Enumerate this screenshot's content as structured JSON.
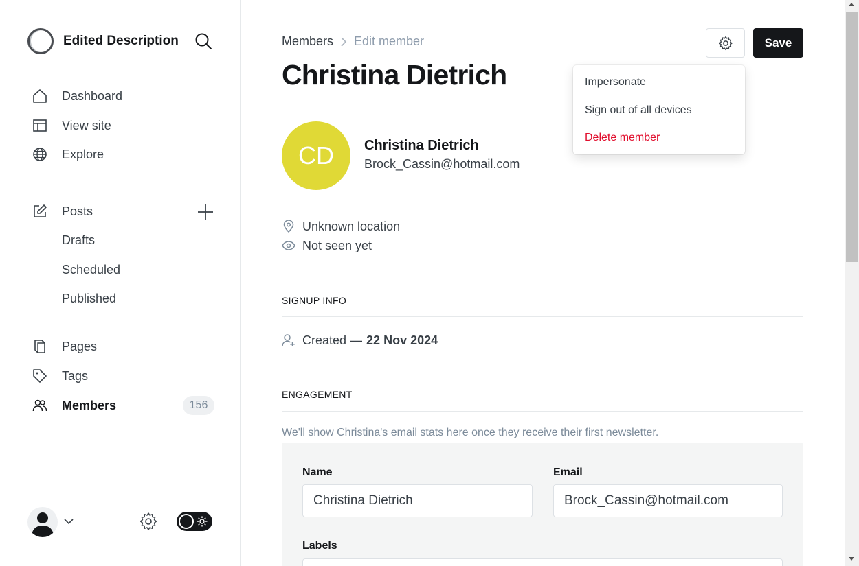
{
  "sidebar": {
    "site_title": "Edited Description",
    "nav": {
      "dashboard": "Dashboard",
      "view_site": "View site",
      "explore": "Explore",
      "posts": "Posts",
      "drafts": "Drafts",
      "scheduled": "Scheduled",
      "published": "Published",
      "pages": "Pages",
      "tags": "Tags",
      "members": "Members",
      "members_count": "156"
    }
  },
  "header": {
    "breadcrumb_parent": "Members",
    "breadcrumb_current": "Edit member",
    "title": "Christina Dietrich",
    "save_label": "Save"
  },
  "actions_menu": {
    "impersonate": "Impersonate",
    "sign_out": "Sign out of all devices",
    "delete": "Delete member"
  },
  "member": {
    "initials": "CD",
    "name": "Christina Dietrich",
    "email": "Brock_Cassin@hotmail.com",
    "location": "Unknown location",
    "last_seen": "Not seen yet",
    "avatar_color": "#e0d936"
  },
  "signup": {
    "heading": "SIGNUP INFO",
    "created_prefix": "Created —",
    "created_date": "22 Nov 2024"
  },
  "engagement": {
    "heading": "ENGAGEMENT",
    "note": "We'll show Christina's email stats here once they receive their first newsletter."
  },
  "form": {
    "name_label": "Name",
    "name_value": "Christina Dietrich",
    "email_label": "Email",
    "email_value": "Brock_Cassin@hotmail.com",
    "labels_label": "Labels"
  },
  "colors": {
    "accent": "#15171a",
    "danger": "#e10e2d"
  }
}
